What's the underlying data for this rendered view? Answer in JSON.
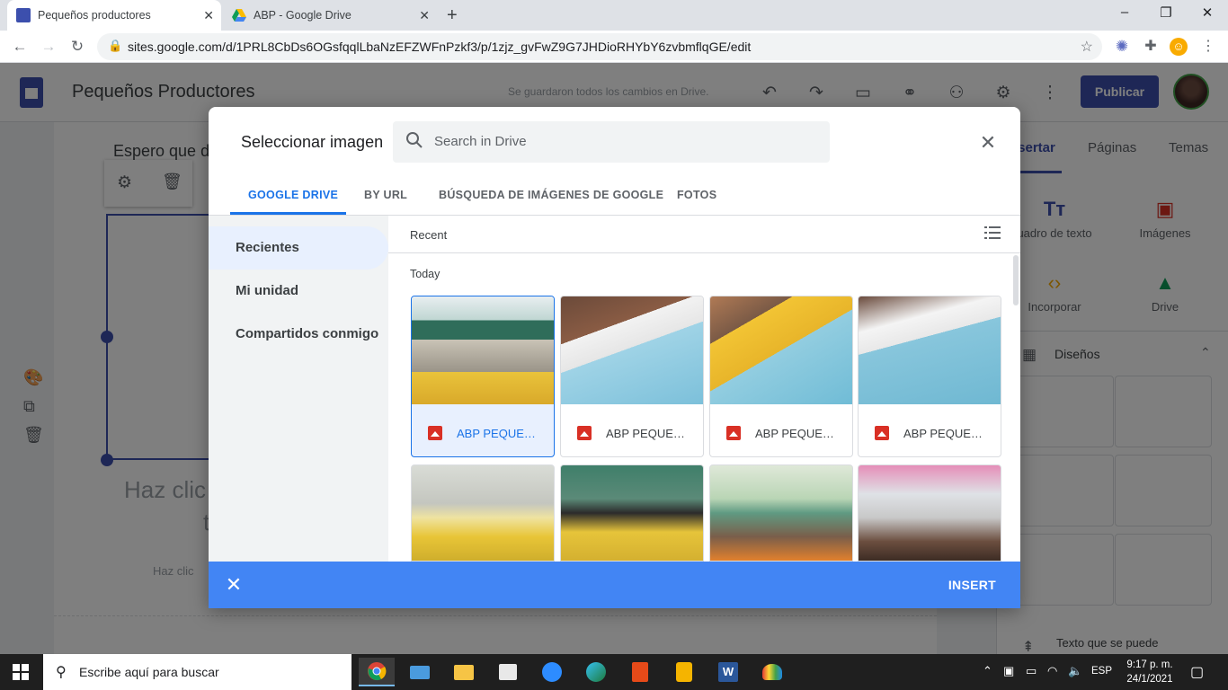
{
  "browser": {
    "tabs": [
      {
        "title": "Pequeños productores",
        "active": true
      },
      {
        "title": "ABP - Google Drive",
        "active": false
      }
    ],
    "url": "sites.google.com/d/1PRL8CbDs6OGsfqqlLbaNzEFZWFnPzkf3/p/1zjz_gvFwZ9G7JHDioRHYbY6zvbmflqGE/edit"
  },
  "sites_header": {
    "title": "Pequeños Productores",
    "save_status": "Se guardaron todos los cambios en Drive.",
    "publish_label": "Publicar"
  },
  "page_bg": {
    "heading_fragment": "Espero que d",
    "click_prompt": "Haz clic p",
    "click_prompt_2": "t",
    "click_small": "Haz clic"
  },
  "right_panel": {
    "tabs": [
      "nsertar",
      "Páginas",
      "Temas"
    ],
    "items": [
      {
        "label": "uadro de texto",
        "icon": "text-box-icon"
      },
      {
        "label": "Imágenes",
        "icon": "image-icon"
      },
      {
        "label": "Incorporar",
        "icon": "embed-icon"
      },
      {
        "label": "Drive",
        "icon": "drive-icon"
      }
    ],
    "designs_label": "Diseños",
    "bottom_text": "Texto que se puede"
  },
  "dialog": {
    "title": "Seleccionar imagen",
    "search_placeholder": "Search in Drive",
    "tabs": [
      "GOOGLE DRIVE",
      "BY URL",
      "BÚSQUEDA DE IMÁGENES DE GOOGLE",
      "FOTOS"
    ],
    "active_tab": 0,
    "nav": [
      "Recientes",
      "Mi unidad",
      "Compartidos conmigo"
    ],
    "active_nav": 0,
    "recent_label": "Recent",
    "section_label": "Today",
    "files": [
      {
        "name": "ABP PEQUEÑ...",
        "selected": true
      },
      {
        "name": "ABP PEQUEÑ...",
        "selected": false
      },
      {
        "name": "ABP PEQUEÑ...",
        "selected": false
      },
      {
        "name": "ABP PEQUEÑ...",
        "selected": false
      }
    ],
    "insert_label": "INSERT"
  },
  "taskbar": {
    "search_placeholder": "Escribe aquí para buscar",
    "language": "ESP",
    "time": "9:17 p. m.",
    "date": "24/1/2021"
  }
}
